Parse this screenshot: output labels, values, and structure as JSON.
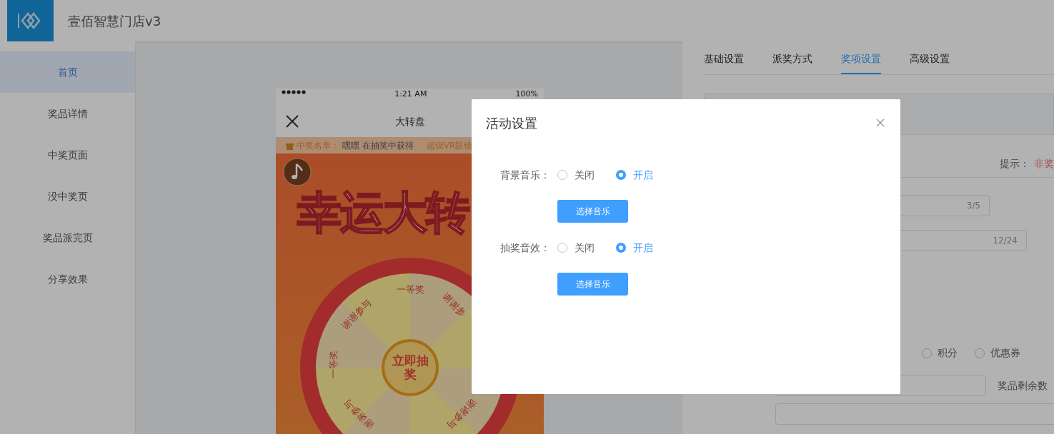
{
  "header": {
    "title": "壹佰智慧门店v3"
  },
  "sidebar": {
    "items": [
      {
        "label": "首页",
        "selected": true
      },
      {
        "label": "奖品详情",
        "selected": false
      },
      {
        "label": "中奖页面",
        "selected": false
      },
      {
        "label": "没中奖页",
        "selected": false
      },
      {
        "label": "奖品派完页",
        "selected": false
      },
      {
        "label": "分享效果",
        "selected": false
      }
    ]
  },
  "phone": {
    "status_bar": {
      "time": "1:21 AM",
      "battery": "100%"
    },
    "nav": {
      "title": "大转盘"
    },
    "ticker": {
      "label": "中奖名单：",
      "text": "嘿嘿 在抽奖中获得",
      "prize": "超级VR眼镜"
    },
    "poster": {
      "title": "幸运大转",
      "wheel_labels": [
        "一等奖",
        "谢谢参与",
        "谢谢参",
        "一等奖",
        "谢谢参与",
        "谢谢参与"
      ],
      "start_button": "立即抽奖"
    }
  },
  "settings": {
    "tabs": [
      {
        "label": "基础设置",
        "selected": false
      },
      {
        "label": "派奖方式",
        "selected": false
      },
      {
        "label": "奖项设置",
        "selected": true
      },
      {
        "label": "高级设置",
        "selected": false
      }
    ],
    "hint_label": "提示：",
    "hint_text": "非奖",
    "name_counter": "3/5",
    "desc_counter": "12/24",
    "prize_types": [
      {
        "label": "积分",
        "selected": false
      },
      {
        "label": "优惠券",
        "selected": false
      }
    ],
    "remaining_label": "奖品剩余数"
  },
  "dialog": {
    "title": "活动设置",
    "rows": [
      {
        "label": "背景音乐：",
        "options": [
          {
            "label": "关闭",
            "selected": false
          },
          {
            "label": "开启",
            "selected": true
          }
        ],
        "button": "选择音乐"
      },
      {
        "label": "抽奖音效：",
        "options": [
          {
            "label": "关闭",
            "selected": false
          },
          {
            "label": "开启",
            "selected": true
          }
        ],
        "button": "选择音乐"
      }
    ]
  }
}
